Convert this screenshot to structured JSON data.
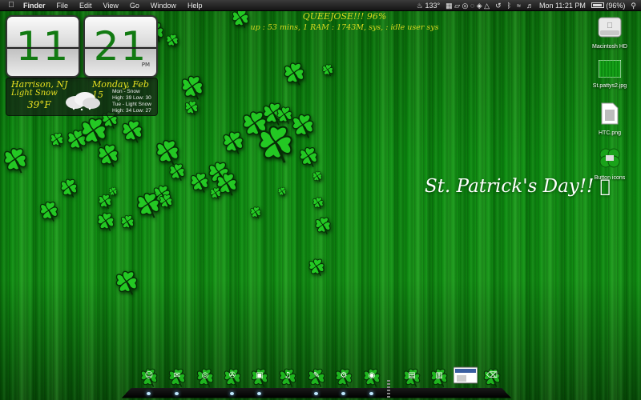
{
  "menubar": {
    "app": "Finder",
    "items": [
      "File",
      "Edit",
      "View",
      "Go",
      "Window",
      "Help"
    ],
    "status": {
      "temperature": "133°",
      "datetime": "Mon 11:21 PM",
      "battery": "(96%)",
      "battery_level": 0.96
    }
  },
  "clock": {
    "hour": "11",
    "minute": "21",
    "ampm": "PM"
  },
  "weather": {
    "city": "Harrison, NJ",
    "condition": "Light Snow",
    "temp": "39°F",
    "date": "Monday, Feb 15",
    "forecast": [
      "Mon - Snow",
      "High: 39 Low: 30",
      "Tue - Light Snow",
      "High: 34 Low: 27"
    ]
  },
  "stats": {
    "line1": "QUEEJOSE!!! 96%",
    "line2": "up : 53 mins, 1 RAM : 1743M, sys, : idle user sys"
  },
  "desktop_icons": [
    {
      "label": "Macintosh HD",
      "icon": "hard-drive-icon"
    },
    {
      "label": "St.pattys2.jpg",
      "icon": "image-file-icon"
    },
    {
      "label": "HTC.png",
      "icon": "png-file-icon"
    },
    {
      "label": "Button icons",
      "icon": "folder-clover-icon"
    }
  ],
  "greeting": "St. Patrick's Day!!",
  "dock": {
    "items": [
      {
        "icon": "finder-icon"
      },
      {
        "icon": "mail-icon"
      },
      {
        "icon": "safari-icon"
      },
      {
        "icon": "firefox-icon"
      },
      {
        "icon": "iphoto-icon"
      },
      {
        "icon": "itunes-icon"
      },
      {
        "icon": "text-edit-icon"
      },
      {
        "icon": "system-preferences-icon"
      },
      {
        "icon": "photo-booth-icon"
      },
      {
        "icon": "applications-folder-icon"
      },
      {
        "icon": "documents-folder-icon"
      },
      {
        "icon": "downloads-stack-icon"
      },
      {
        "icon": "trash-icon"
      }
    ]
  },
  "colors": {
    "accent_green": "#127a12",
    "text_yellow": "#d8d820"
  }
}
